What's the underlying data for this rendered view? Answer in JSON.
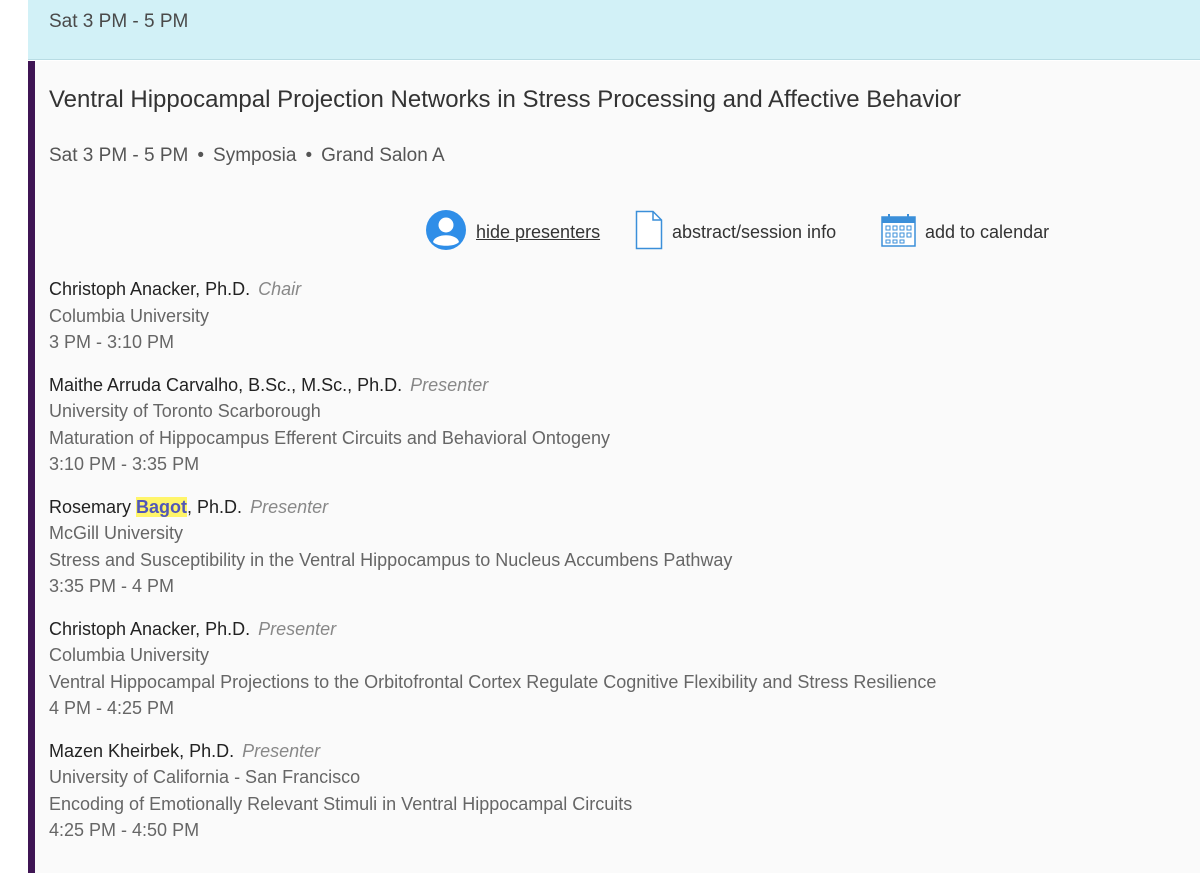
{
  "time_header": "Sat 3 PM - 5 PM",
  "session": {
    "title": "Ventral Hippocampal Projection Networks in Stress Processing and Affective Behavior",
    "meta": {
      "time": "Sat 3 PM - 5 PM",
      "type": "Symposia",
      "location": "Grand Salon A",
      "separator": "•"
    },
    "actions": {
      "hide_presenters": "hide presenters",
      "abstract": "abstract/session info",
      "calendar": "add to calendar"
    },
    "presenters": [
      {
        "name": "Christoph Anacker, Ph.D.",
        "role": "Chair",
        "affiliation": "Columbia University",
        "time": "3 PM - 3:10 PM"
      },
      {
        "name": "Maithe Arruda Carvalho, B.Sc., M.Sc., Ph.D.",
        "role": "Presenter",
        "affiliation": "University of Toronto Scarborough",
        "talk": "Maturation of Hippocampus Efferent Circuits and Behavioral Ontogeny",
        "time": "3:10 PM - 3:35 PM"
      },
      {
        "name_before": "Rosemary ",
        "name_highlight": "Bagot",
        "name_after": ", Ph.D.",
        "role": "Presenter",
        "affiliation": "McGill University",
        "talk": "Stress and Susceptibility in the Ventral Hippocampus to Nucleus Accumbens Pathway",
        "time": "3:35 PM - 4 PM"
      },
      {
        "name": "Christoph Anacker, Ph.D.",
        "role": "Presenter",
        "affiliation": "Columbia University",
        "talk": "Ventral Hippocampal Projections to the Orbitofrontal Cortex Regulate Cognitive Flexibility and Stress Resilience",
        "time": "4 PM - 4:25 PM"
      },
      {
        "name": "Mazen Kheirbek, Ph.D.",
        "role": "Presenter",
        "affiliation": "University of California - San Francisco",
        "talk": "Encoding of Emotionally Relevant Stimuli in Ventral Hippocampal Circuits",
        "time": "4:25 PM - 4:50 PM"
      }
    ]
  },
  "icons": {
    "hide_presenters": "user-avatar-icon",
    "abstract": "document-icon",
    "calendar": "calendar-icon"
  },
  "colors": {
    "header_bg": "#d2f1f7",
    "accent_bar": "#3f1554",
    "avatar_blue": "#2f8ee8",
    "highlight": "#fff56a",
    "highlight_text": "#5157b8"
  }
}
